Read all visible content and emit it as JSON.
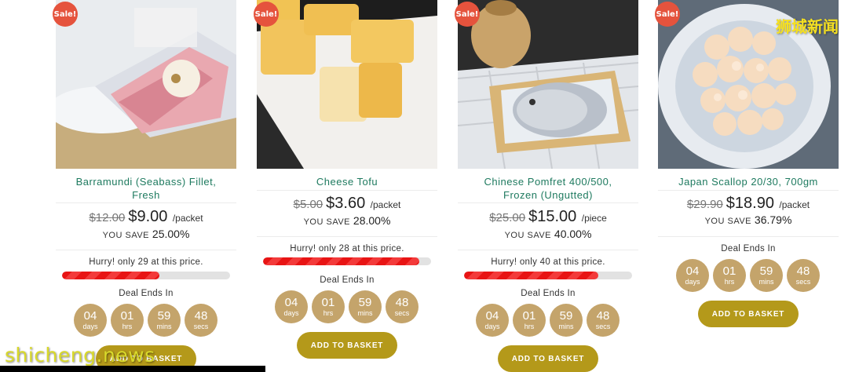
{
  "sale_badge": "Sale!",
  "deal_label": "Deal Ends In",
  "save_label": "YOU SAVE",
  "basket_label": "ADD TO BASKET",
  "timer": {
    "days": "04",
    "hrs": "01",
    "mins": "59",
    "secs": "48",
    "days_u": "days",
    "hrs_u": "hrs",
    "mins_u": "mins",
    "secs_u": "secs"
  },
  "products": [
    {
      "title1": "Barramundi (Seabass) Fillet,",
      "title2": "Fresh",
      "old_price": "$12.00",
      "price": "$9.00",
      "unit": "/packet",
      "save": "25.00%",
      "hurry": "Hurry! only 29 at this price.",
      "stock_fill": 0.58
    },
    {
      "title1": "Cheese Tofu",
      "old_price": "$5.00",
      "price": "$3.60",
      "unit": "/packet",
      "save": "28.00%",
      "hurry": "Hurry! only 28 at this price.",
      "stock_fill": 0.93
    },
    {
      "title1": "Chinese Pomfret 400/500,",
      "title2": "Frozen (Ungutted)",
      "old_price": "$25.00",
      "price": "$15.00",
      "unit": "/piece",
      "save": "40.00%",
      "hurry": "Hurry! only 40 at this price.",
      "stock_fill": 0.8
    },
    {
      "title1": "Japan Scallop 20/30, 700gm",
      "old_price": "$29.90",
      "price": "$18.90",
      "unit": "/packet",
      "save": "36.79%"
    }
  ],
  "watermark_cn": "狮城新闻",
  "watermark_en": "shicheng.news"
}
